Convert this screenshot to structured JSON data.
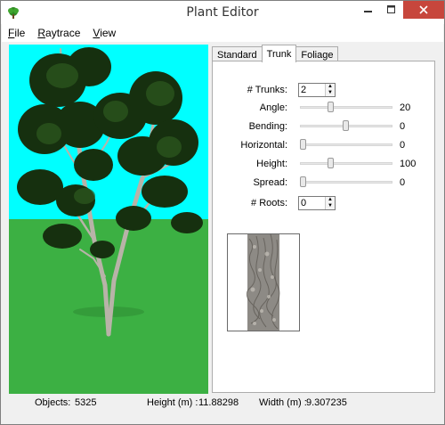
{
  "window": {
    "title": "Plant Editor"
  },
  "menu": [
    {
      "underline": "F",
      "rest": "ile"
    },
    {
      "underline": "R",
      "rest": "aytrace"
    },
    {
      "underline": "V",
      "rest": "iew"
    }
  ],
  "tabs": [
    "Standard",
    "Trunk",
    "Foliage"
  ],
  "active_tab": "Trunk",
  "trunk": {
    "trunks_label": "# Trunks:",
    "trunks_value": "2",
    "angle_label": "Angle:",
    "angle_value": "20",
    "bending_label": "Bending:",
    "bending_value": "0",
    "horizontal_label": "Horizontal:",
    "horizontal_value": "0",
    "height_label": "Height:",
    "height_value": "100",
    "spread_label": "Spread:",
    "spread_value": "0",
    "roots_label": "# Roots:",
    "roots_value": "0"
  },
  "status": {
    "objects_label": "Objects:",
    "objects_value": "5325",
    "height_label": "Height (m) :",
    "height_value": "11.88298",
    "width_label": "Width (m) :",
    "width_value": "9.307235"
  },
  "colors": {
    "sky": "#00ffff",
    "ground": "#3cb043",
    "foliage": "#16300f",
    "close_button": "#c7463c"
  }
}
